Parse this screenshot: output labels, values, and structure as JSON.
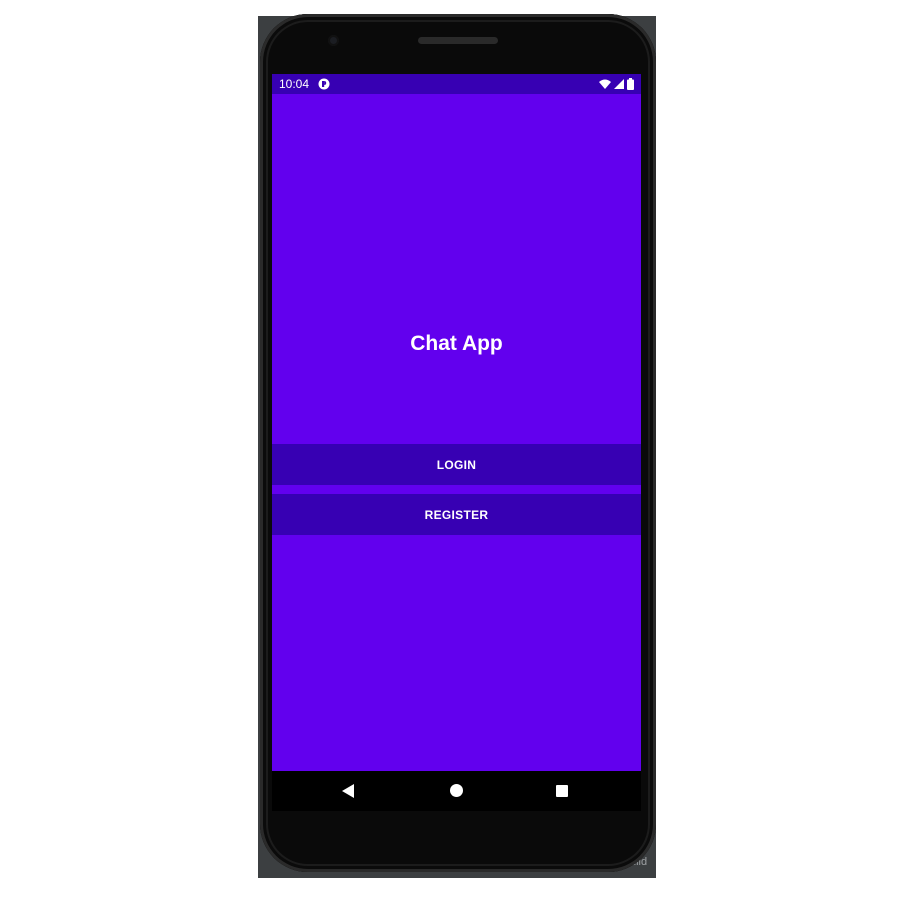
{
  "status_bar": {
    "time": "10:04",
    "icons": [
      "app-notification-icon",
      "wifi-icon",
      "signal-icon",
      "battery-icon"
    ]
  },
  "app": {
    "title": "Chat App",
    "login_label": "LOGIN",
    "register_label": "REGISTER"
  },
  "nav_bar": {
    "buttons": [
      "back",
      "home",
      "recents"
    ]
  },
  "ide": {
    "build_fragment": "uild"
  },
  "colors": {
    "primary": "#6200ee",
    "primary_dark": "#3700b3",
    "on_primary": "#ffffff"
  }
}
